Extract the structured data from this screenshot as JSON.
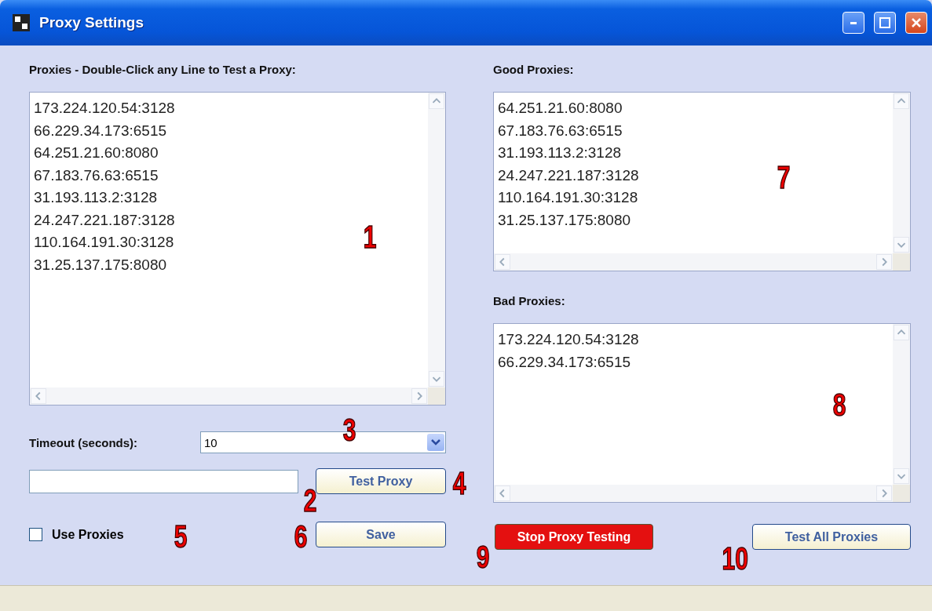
{
  "window": {
    "title": "Proxy Settings"
  },
  "proxies": {
    "label": "Proxies - Double-Click any Line to Test a Proxy:",
    "lines": [
      "173.224.120.54:3128",
      "66.229.34.173:6515",
      "64.251.21.60:8080",
      "67.183.76.63:6515",
      "31.193.113.2:3128",
      "24.247.221.187:3128",
      "110.164.191.30:3128",
      "31.25.137.175:8080"
    ]
  },
  "timeout": {
    "label": "Timeout (seconds):",
    "value": "10"
  },
  "test_proxy": {
    "label": "Test Proxy"
  },
  "use_proxies": {
    "label": "Use Proxies",
    "checked": false
  },
  "save": {
    "label": "Save"
  },
  "good": {
    "label": "Good Proxies:",
    "lines": [
      "64.251.21.60:8080",
      "67.183.76.63:6515",
      "31.193.113.2:3128",
      "24.247.221.187:3128",
      "110.164.191.30:3128",
      "31.25.137.175:8080"
    ]
  },
  "bad": {
    "label": "Bad Proxies:",
    "lines": [
      "173.224.120.54:3128",
      "66.229.34.173:6515"
    ]
  },
  "stop": {
    "label": "Stop Proxy Testing"
  },
  "test_all": {
    "label": "Test All Proxies"
  },
  "annotations": [
    "1",
    "2",
    "3",
    "4",
    "5",
    "6",
    "7",
    "8",
    "9",
    "10"
  ]
}
